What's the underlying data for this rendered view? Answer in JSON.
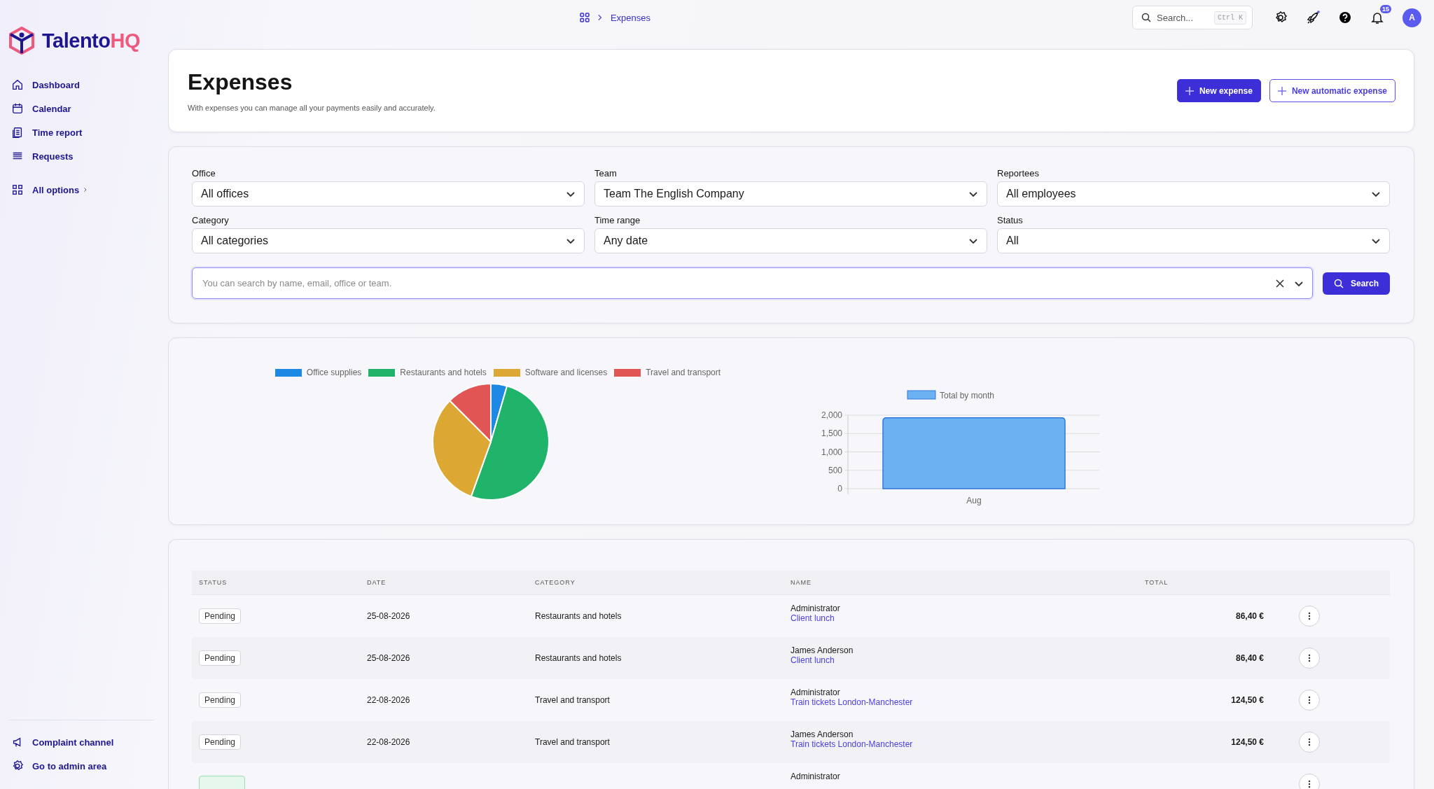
{
  "logo": {
    "main": "Talento",
    "accent": "HQ"
  },
  "sidebar": {
    "items": [
      {
        "label": "Dashboard"
      },
      {
        "label": "Calendar"
      },
      {
        "label": "Time report"
      },
      {
        "label": "Requests"
      }
    ],
    "all_options": "All options",
    "footer": [
      {
        "label": "Complaint channel"
      },
      {
        "label": "Go to admin area"
      }
    ]
  },
  "topbar": {
    "breadcrumb": "Expenses",
    "search_placeholder": "Search...",
    "shortcut": "Ctrl K",
    "notifications": "15",
    "avatar": "A"
  },
  "header": {
    "title": "Expenses",
    "subtitle": "With expenses you can manage all your payments easily and accurately.",
    "buttons": [
      {
        "label": "New expense",
        "kind": "primary"
      },
      {
        "label": "New automatic expense",
        "kind": "outline"
      }
    ]
  },
  "filters": [
    {
      "label": "Office",
      "value": "All offices"
    },
    {
      "label": "Team",
      "value": "Team The English Company"
    },
    {
      "label": "Reportees",
      "value": "All employees"
    },
    {
      "label": "Category",
      "value": "All categories"
    },
    {
      "label": "Time range",
      "value": "Any date"
    },
    {
      "label": "Status",
      "value": "All"
    }
  ],
  "search": {
    "placeholder": "You can search by name, email, office or team.",
    "button": "Search"
  },
  "charts": [
    {
      "chart_data": {
        "type": "pie",
        "categories": [
          "Office supplies",
          "Restaurants and hotels",
          "Software and licenses",
          "Travel and transport"
        ],
        "values": [
          4.5,
          51,
          32,
          12.5
        ],
        "colors": [
          "#1e88e5",
          "#20b46a",
          "#dca733",
          "#e25555"
        ],
        "legend": true
      }
    },
    {
      "chart_data": {
        "type": "bar",
        "categories": [
          "Aug"
        ],
        "series": [
          {
            "name": "Total by month",
            "color": "#6cb2f2",
            "values": [
              1930
            ]
          }
        ],
        "legend": true,
        "grid": true,
        "ylim": [
          0,
          2000
        ],
        "yticks": [
          {
            "value": 0,
            "label": "0"
          },
          {
            "value": 500,
            "label": "500"
          },
          {
            "value": 1000,
            "label": "1,000"
          },
          {
            "value": 1500,
            "label": "1,500"
          },
          {
            "value": 2000,
            "label": "2,000"
          }
        ]
      }
    }
  ],
  "table": {
    "columns": [
      "STATUS",
      "DATE",
      "CATEGORY",
      "NAME",
      "TOTAL"
    ],
    "rows": [
      {
        "status": "Pending",
        "kind": "pending",
        "date": "25-08-2026",
        "category": "Restaurants and hotels",
        "name": "Administrator",
        "description": "Client lunch",
        "total": "86,40 €"
      },
      {
        "status": "Pending",
        "kind": "pending",
        "date": "25-08-2026",
        "category": "Restaurants and hotels",
        "name": "James Anderson",
        "description": "Client lunch",
        "total": "86,40 €"
      },
      {
        "status": "Pending",
        "kind": "pending",
        "date": "22-08-2026",
        "category": "Travel and transport",
        "name": "Administrator",
        "description": "Train tickets London-Manchester",
        "total": "124,50 €"
      },
      {
        "status": "Pending",
        "kind": "pending",
        "date": "22-08-2026",
        "category": "Travel and transport",
        "name": "James Anderson",
        "description": "Train tickets London-Manchester",
        "total": "124,50 €"
      },
      {
        "kind": "approved",
        "name": "Administrator"
      }
    ]
  }
}
